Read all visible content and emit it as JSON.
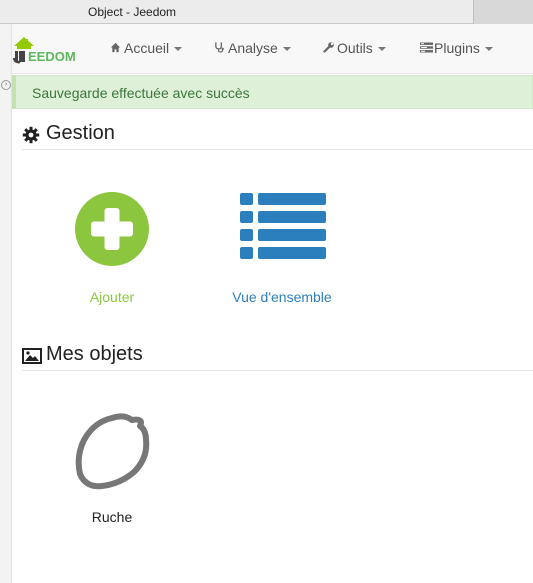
{
  "window": {
    "title": "Object - Jeedom"
  },
  "brand": {
    "logo_text": "EEDOM",
    "accent": "#94ca02"
  },
  "navbar": {
    "items": [
      {
        "label": "Accueil",
        "icon": "home-icon"
      },
      {
        "label": "Analyse",
        "icon": "stethoscope-icon"
      },
      {
        "label": "Outils",
        "icon": "wrench-icon"
      },
      {
        "label": "Plugins",
        "icon": "tasks-icon"
      }
    ]
  },
  "alert": {
    "message": "Sauvegarde effectuée avec succès",
    "color": "#3c763d"
  },
  "gestion": {
    "title": "Gestion",
    "icon": "gear-icon",
    "actions": [
      {
        "label": "Ajouter",
        "icon": "plus-circle-icon",
        "color": "#8cc63f"
      },
      {
        "label": "Vue d'ensemble",
        "icon": "list-icon",
        "color": "#2c7fbd"
      }
    ]
  },
  "objects": {
    "title": "Mes objets",
    "icon": "picture-icon",
    "items": [
      {
        "label": "Ruche",
        "icon": "lemon-icon",
        "color": "#777777"
      }
    ]
  }
}
